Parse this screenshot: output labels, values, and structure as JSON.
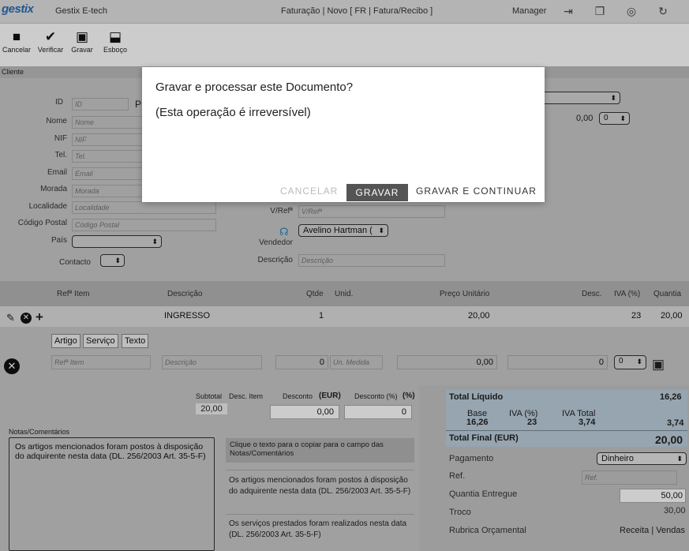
{
  "topbar": {
    "logo": "gestix",
    "company": "Gestix E-tech",
    "doc_title": "Faturação | Novo [ FR | Fatura/Recibo ]",
    "user": "Manager"
  },
  "toolbar": {
    "cancel": "Cancelar",
    "verify": "Verificar",
    "save": "Gravar",
    "draft": "Esboço"
  },
  "client": {
    "section": "Cliente",
    "id_label": "ID",
    "id_ph": "ID",
    "nome_label": "Nome",
    "nome_ph": "Nome",
    "nif_label": "NIF",
    "nif_ph": "NIF",
    "tel_label": "Tel.",
    "tel_ph": "Tel.",
    "email_label": "Email",
    "email_ph": "Email",
    "morada_label": "Morada",
    "morada_ph": "Morada",
    "localidade_label": "Localidade",
    "localidade_ph": "Localidade",
    "cp_label": "Código Postal",
    "cp_ph": "Código Postal",
    "pais_label": "País",
    "contacto_label": "Contacto",
    "p_fragment": "P"
  },
  "doc": {
    "vref_label": "V/Refª",
    "vref_ph": "V/Refª",
    "vendedor_label": "Vendedor",
    "vendedor_value": "Avelino Hartman (",
    "descricao_label": "Descrição",
    "descricao_ph": "Descrição",
    "discount_value": "0,00",
    "discount_select": "0"
  },
  "grid": {
    "headers": {
      "ref": "Refª Item",
      "desc": "Descrição",
      "qty": "Qtde",
      "unit": "Unid.",
      "price": "Preço Unitário",
      "disc": "Desc.",
      "iva": "IVA (%)",
      "amount": "Quantia"
    },
    "row": {
      "desc": "INGRESSO",
      "qty": "1",
      "price": "20,00",
      "iva": "23",
      "amount": "20,00"
    }
  },
  "editor": {
    "artigo": "Artigo",
    "servico": "Serviço",
    "texto": "Texto",
    "ref_ph": "Refª Item",
    "desc_ph": "Descrição",
    "qty": "0",
    "unit_ph": "Un. Medida",
    "price": "0,00",
    "disc": "0",
    "iva": "0"
  },
  "totals": {
    "subtotal_label": "Subtotal",
    "subtotal": "20,00",
    "desc_item_label": "Desc. Item",
    "desconto_label": "Desconto",
    "eur": "(EUR)",
    "desconto_value": "0,00",
    "desconto_pct_label": "Desconto (%)",
    "pct": "(%)",
    "desconto_pct_value": "0"
  },
  "notes": {
    "label": "Notas/Comentários",
    "text": "Os artigos mencionados foram postos à disposição do adquirente nesta data (DL. 256/2003 Art. 35-5-F)",
    "hint": "Clique o texto para o copiar para o campo das Notas/Comentários",
    "option1": "Os artigos mencionados foram postos à disposição do adquirente nesta data (DL. 256/2003 Art. 35-5-F)",
    "option2": "Os serviços prestados foram realizados nesta data (DL. 256/2003 Art. 35-5-F)"
  },
  "summary": {
    "liquido_label": "Total Líquido",
    "liquido": "16,26",
    "base_label": "Base",
    "base": "16,26",
    "iva_label": "IVA (%)",
    "iva": "23",
    "iva_total_label": "IVA Total",
    "iva_total": "3,74",
    "iva_total_right": "3,74",
    "final_label": "Total Final (EUR)",
    "final": "20,00",
    "pagamento_label": "Pagamento",
    "pagamento": "Dinheiro",
    "ref_label": "Ref.",
    "ref_ph": "Ref.",
    "entregue_label": "Quantia Entregue",
    "entregue": "50,00",
    "troco_label": "Troco",
    "troco": "30,00",
    "rubrica_label": "Rubrica Orçamental",
    "rubrica": "Receita | Vendas"
  },
  "dialog": {
    "title": "Gravar e processar este Documento?",
    "message": "(Esta operação é irreversível)",
    "cancel": "CANCELAR",
    "save": "GRAVAR",
    "save_continue": "GRAVAR E CONTINUAR"
  },
  "icons": [
    "logout-icon",
    "copy-icon",
    "help-icon",
    "refresh-icon",
    "stop-icon",
    "check-icon",
    "save-icon",
    "draft-icon",
    "edit-icon",
    "remove-icon",
    "add-icon",
    "headset-icon"
  ]
}
